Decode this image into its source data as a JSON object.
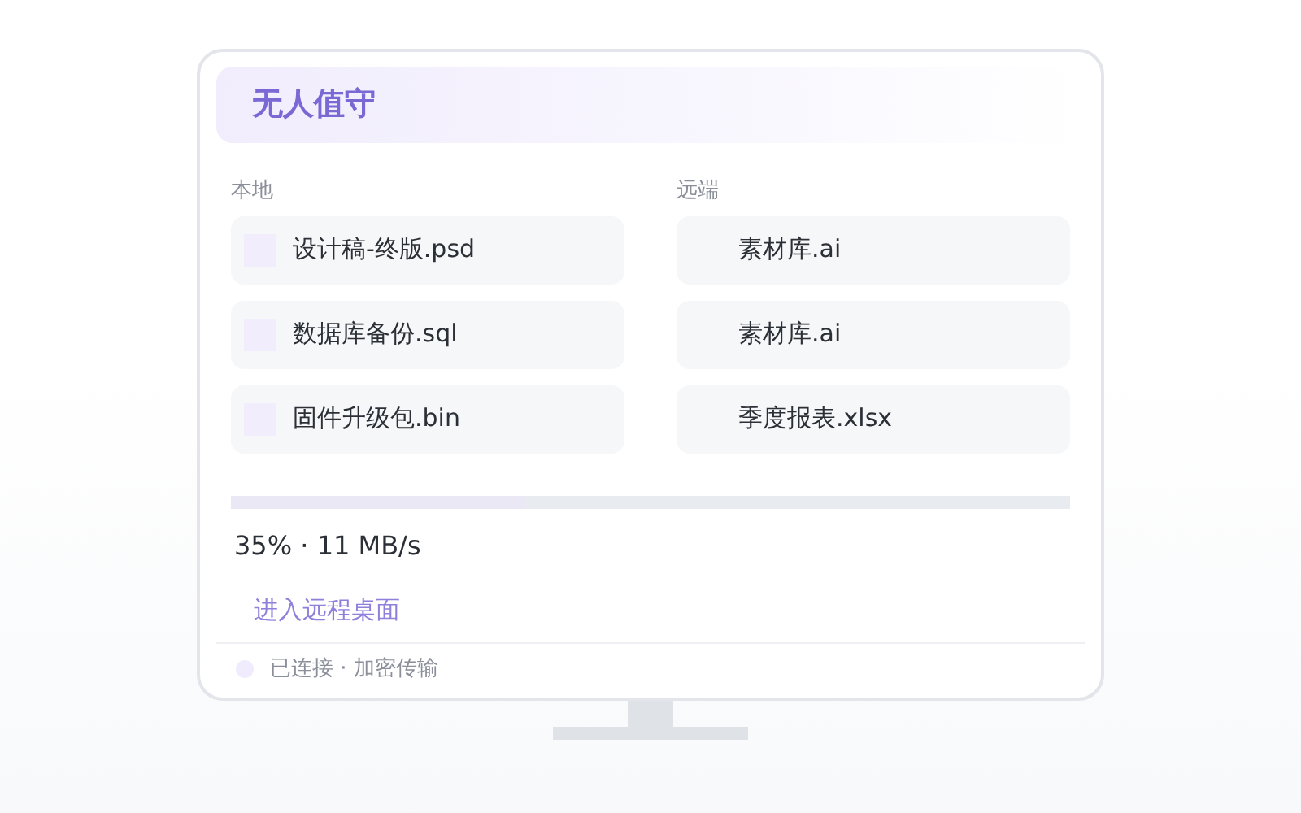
{
  "header": {
    "title": "无人值守"
  },
  "local": {
    "label": "本地",
    "files": [
      {
        "name": "设计稿-终版.psd"
      },
      {
        "name": "数据库备份.sql"
      },
      {
        "name": "固件升级包.bin"
      }
    ]
  },
  "remote": {
    "label": "远端",
    "files": [
      {
        "name": "素材库.ai"
      },
      {
        "name": "素材库.ai"
      },
      {
        "name": "季度报表.xlsx"
      }
    ]
  },
  "transfer": {
    "level": 0.35,
    "reading": "35% · 11 MB/s"
  },
  "action_button": "进入远程桌面",
  "status": {
    "text": "已连接 · 加密传输",
    "color": "#f0ecfd"
  }
}
